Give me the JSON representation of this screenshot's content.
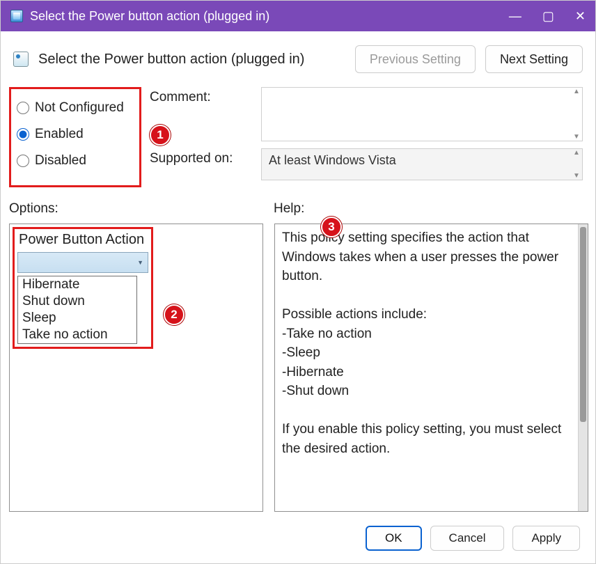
{
  "window": {
    "title": "Select the Power button action (plugged in)"
  },
  "header": {
    "title": "Select the Power button action (plugged in)",
    "prev_label": "Previous Setting",
    "next_label": "Next Setting"
  },
  "state_radios": {
    "not_configured": "Not Configured",
    "enabled": "Enabled",
    "disabled": "Disabled",
    "selected": "enabled"
  },
  "form": {
    "comment_label": "Comment:",
    "comment_value": "",
    "supported_label": "Supported on:",
    "supported_value": "At least Windows Vista"
  },
  "sections": {
    "options_label": "Options:",
    "help_label": "Help:"
  },
  "options": {
    "group_label": "Power Button Action",
    "combo_selected": "",
    "items": [
      "Hibernate",
      "Shut down",
      "Sleep",
      "Take no action"
    ]
  },
  "help": {
    "text": "This policy setting specifies the action that Windows takes when a user presses the power button.\n\nPossible actions include:\n-Take no action\n-Sleep\n-Hibernate\n-Shut down\n\nIf you enable this policy setting, you must select the desired action."
  },
  "footer": {
    "ok": "OK",
    "cancel": "Cancel",
    "apply": "Apply"
  },
  "badges": {
    "one": "1",
    "two": "2",
    "three": "3"
  }
}
